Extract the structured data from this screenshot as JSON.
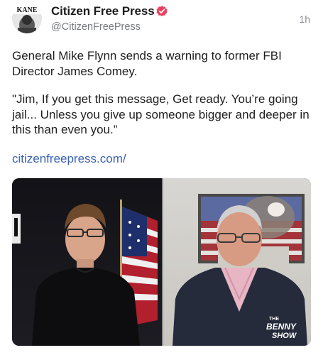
{
  "post": {
    "author": {
      "display_name": "Citizen Free Press",
      "handle": "@CitizenFreePress",
      "avatar_label": "KANE",
      "verified": true
    },
    "timestamp": "1h",
    "paragraphs": [
      "General Mike Flynn sends a warning to former FBI Director James Comey.",
      "\"Jim, If you get this message, Get ready. You’re going jail... Unless you give up someone bigger and deeper in this than even you.”"
    ],
    "link_text": "citizenfreepress.com/",
    "media": {
      "watermark_line1": "THE",
      "watermark_line2": "BENNY",
      "watermark_line3": "SHOW"
    }
  },
  "colors": {
    "verified": "#e8405f",
    "link": "#3a62b3",
    "handle": "#777b80"
  }
}
